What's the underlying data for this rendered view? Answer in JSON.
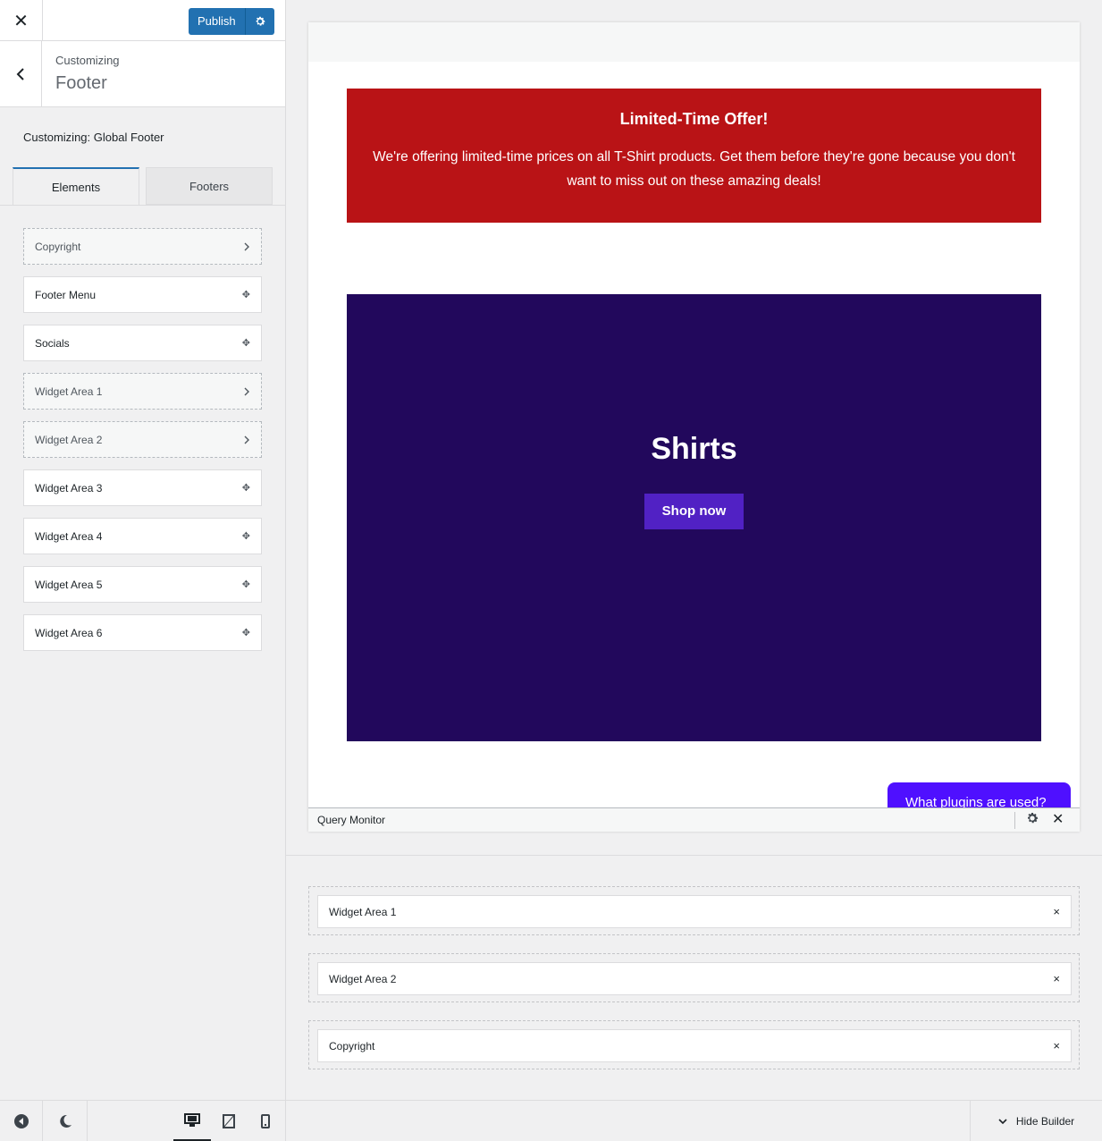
{
  "topbar": {
    "close_glyph": "✕",
    "publish_label": "Publish"
  },
  "section": {
    "pre_title": "Customizing",
    "title": "Footer"
  },
  "global_label": "Customizing: Global Footer",
  "tabs": [
    {
      "label": "Elements",
      "active": true
    },
    {
      "label": "Footers",
      "active": false
    }
  ],
  "elements": [
    {
      "label": "Copyright",
      "placed": true
    },
    {
      "label": "Footer Menu",
      "placed": false
    },
    {
      "label": "Socials",
      "placed": false
    },
    {
      "label": "Widget Area 1",
      "placed": true
    },
    {
      "label": "Widget Area 2",
      "placed": true
    },
    {
      "label": "Widget Area 3",
      "placed": false
    },
    {
      "label": "Widget Area 4",
      "placed": false
    },
    {
      "label": "Widget Area 5",
      "placed": false
    },
    {
      "label": "Widget Area 6",
      "placed": false
    }
  ],
  "preview": {
    "offer_title": "Limited-Time Offer!",
    "offer_text": "We're offering limited-time prices on all T-Shirt products. Get them before they're gone because you don't want to miss out on these amazing deals!",
    "hero_title": "Shirts",
    "hero_button": "Shop now",
    "plugins_button": "What plugins are used?",
    "query_monitor": "Query Monitor",
    "colors": {
      "offer_bg": "#b91316",
      "hero_bg": "#22085c",
      "shop_btn": "#5121c4",
      "plugins_btn": "#4f10ff"
    }
  },
  "builder": {
    "slots": [
      {
        "label": "Widget Area 1",
        "remove": "×"
      },
      {
        "label": "Widget Area 2",
        "remove": "×"
      },
      {
        "label": "Copyright",
        "remove": "×"
      }
    ]
  },
  "footer": {
    "hide_builder": "Hide Builder"
  },
  "icons": {
    "close": "close-icon",
    "settings": "gear-icon",
    "back": "chevron-left-icon",
    "placed": "chevron-right-icon",
    "drag": "move-icon",
    "collapse": "collapse-icon",
    "dark_mode": "moon-icon",
    "desktop": "desktop-icon",
    "tablet": "tablet-icon",
    "mobile": "mobile-icon",
    "hide": "chevron-down-icon"
  },
  "accent_color": "#2271b1"
}
